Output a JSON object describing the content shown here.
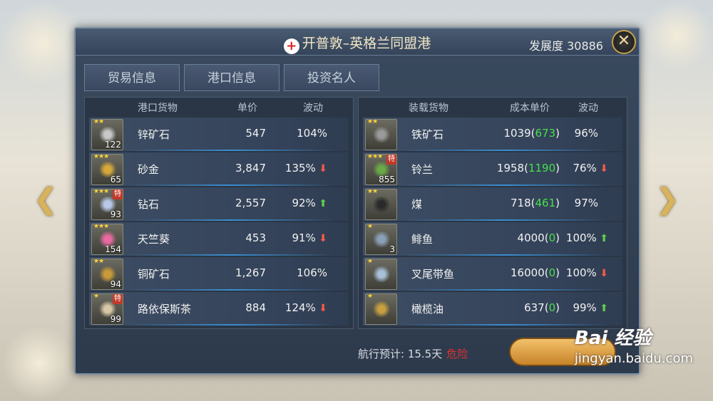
{
  "window": {
    "title": "开普敦–英格兰同盟港",
    "development_label": "发展度 30886",
    "close_symbol": "✕"
  },
  "tabs": [
    {
      "label": "贸易信息",
      "active": true
    },
    {
      "label": "港口信息",
      "active": false
    },
    {
      "label": "投资名人",
      "active": false
    }
  ],
  "port_goods": {
    "headers": [
      "港口货物",
      "单价",
      "波动"
    ],
    "rows": [
      {
        "stars": "★★",
        "qty": "122",
        "special": "",
        "name": "锌矿石",
        "price": "547",
        "change": "104%",
        "trend": ""
      },
      {
        "stars": "★★★",
        "qty": "65",
        "special": "",
        "name": "砂金",
        "price": "3,847",
        "change": "135%",
        "trend": "down"
      },
      {
        "stars": "★★★",
        "qty": "93",
        "special": "特",
        "name": "钻石",
        "price": "2,557",
        "change": "92%",
        "trend": "up"
      },
      {
        "stars": "★★★",
        "qty": "154",
        "special": "",
        "name": "天竺葵",
        "price": "453",
        "change": "91%",
        "trend": "down"
      },
      {
        "stars": "★★",
        "qty": "94",
        "special": "",
        "name": "铜矿石",
        "price": "1,267",
        "change": "106%",
        "trend": ""
      },
      {
        "stars": "★",
        "qty": "99",
        "special": "特",
        "name": "路依保斯茶",
        "price": "884",
        "change": "124%",
        "trend": "down"
      }
    ]
  },
  "cargo_goods": {
    "headers": [
      "装载货物",
      "成本单价",
      "波动"
    ],
    "rows": [
      {
        "stars": "★★",
        "qty": "",
        "special": "",
        "name": "铁矿石",
        "cost": "1039",
        "profit": "673",
        "change": "96%",
        "trend": ""
      },
      {
        "stars": "★★★",
        "qty": "855",
        "special": "特",
        "name": "铃兰",
        "cost": "1958",
        "profit": "1190",
        "change": "76%",
        "trend": "down"
      },
      {
        "stars": "★★",
        "qty": "",
        "special": "",
        "name": "煤",
        "cost": "718",
        "profit": "461",
        "change": "97%",
        "trend": ""
      },
      {
        "stars": "★",
        "qty": "3",
        "special": "",
        "name": "鲱鱼",
        "cost": "4000",
        "profit": "0",
        "change": "100%",
        "trend": "up"
      },
      {
        "stars": "★",
        "qty": "",
        "special": "",
        "name": "叉尾带鱼",
        "cost": "16000",
        "profit": "0",
        "change": "100%",
        "trend": "down"
      },
      {
        "stars": "★",
        "qty": "",
        "special": "",
        "name": "橄榄油",
        "cost": "637",
        "profit": "0",
        "change": "99%",
        "trend": "up"
      }
    ]
  },
  "footer": {
    "voyage_label": "航行预计: 15.5天",
    "danger_label": "危险"
  },
  "watermark": {
    "logo": "Bai 经验",
    "url": "jingyan.baidu.com"
  },
  "colors": {
    "accent_tab": "#1d5f9e",
    "profit_green": "#47e04a",
    "up_arrow": "#5fd34a",
    "down_arrow": "#ff5a4a",
    "danger_red": "#e03030"
  }
}
